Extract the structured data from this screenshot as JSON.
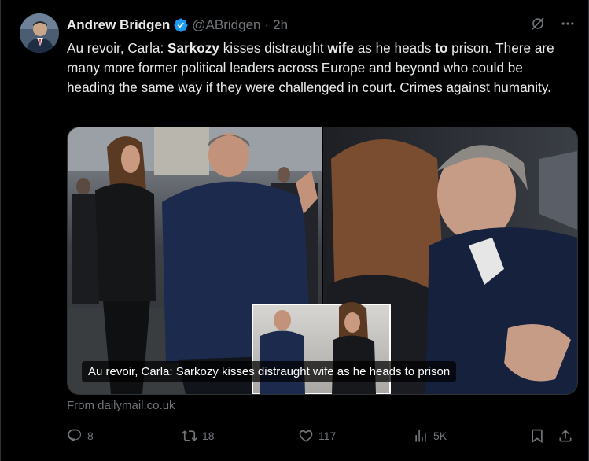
{
  "post": {
    "author_name": "Andrew Bridgen",
    "handle": "@ABridgen",
    "separator": "·",
    "time": "2h",
    "text_parts": {
      "p1": "Au revoir, Carla: ",
      "b1": "Sarkozy",
      "p2": " kisses distraught ",
      "b2": "wife",
      "p3": " as he heads ",
      "b3": "to",
      "p4": " prison. There are many more former political leaders across Europe and beyond who could be heading the same way if they were challenged in court. Crimes against humanity."
    }
  },
  "card": {
    "caption": "Au revoir, Carla: Sarkozy kisses distraught wife as he heads to prison",
    "source": "From dailymail.co.uk"
  },
  "actions": {
    "replies": "8",
    "reposts": "18",
    "likes": "117",
    "views": "5K"
  },
  "icons": {
    "verified": "verified-badge-icon",
    "grok": "grok-icon",
    "more": "more-icon",
    "reply": "reply-icon",
    "repost": "repost-icon",
    "like": "heart-icon",
    "views": "views-icon",
    "bookmark": "bookmark-icon",
    "share": "share-icon"
  },
  "colors": {
    "background": "#000000",
    "text": "#e7e9ea",
    "muted": "#71767b",
    "verified": "#1d9bf0"
  }
}
